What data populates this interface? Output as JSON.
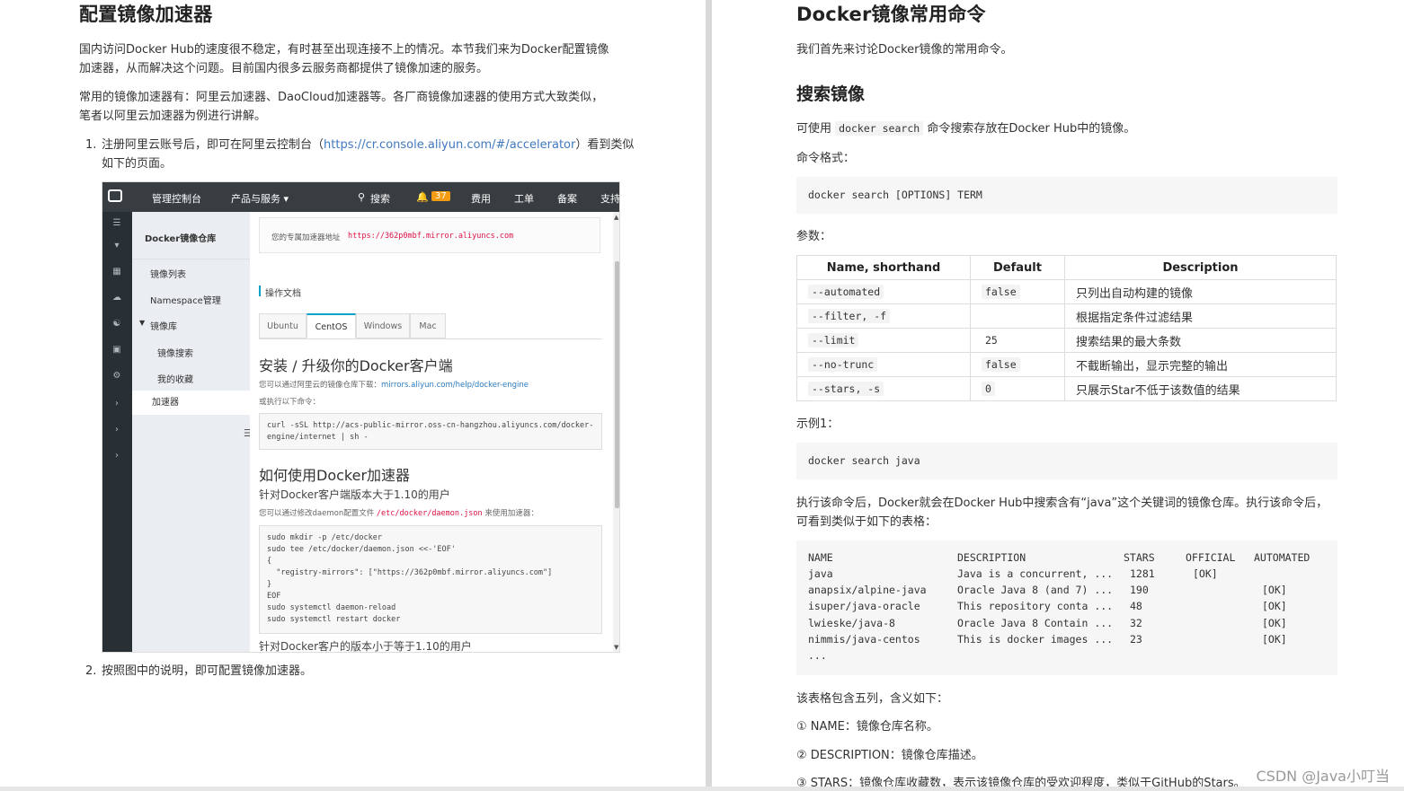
{
  "left": {
    "title": "配置镜像加速器",
    "para1_line1": "国内访问Docker Hub的速度很不稳定，有时甚至出现连接不上的情况。本节我们来为Docker配置镜像",
    "para1_line2": "加速器，从而解决这个问题。目前国内很多云服务商都提供了镜像加速的服务。",
    "para2_line1": "常用的镜像加速器有：阿里云加速器、DaoCloud加速器等。各厂商镜像加速器的使用方式大致类似，",
    "para2_line2": "笔者以阿里云加速器为例进行讲解。",
    "step1_num": "1.",
    "step1_pre": "注册阿里云账号后，即可在阿里云控制台（",
    "step1_link": "https://cr.console.aliyun.com/#/accelerator",
    "step1_post": "）看到类似",
    "step1_line2": "如下的页面。",
    "step2_num": "2.",
    "step2": "按照图中的说明，即可配置镜像加速器。",
    "console": {
      "top_nav": [
        "管理控制台",
        "产品与服务 ▾",
        "搜索",
        "费用",
        "工单",
        "备案",
        "支持"
      ],
      "bell_count": "37",
      "menu_title": "Docker镜像仓库",
      "menu_items": [
        "镜像列表",
        "Namespace管理",
        "镜像库",
        "镜像搜索",
        "我的收藏",
        "加速器"
      ],
      "addr_label": "您的专属加速器地址",
      "addr_url": "https://362p0mbf.mirror.aliyuncs.com",
      "doc_label": "操作文档",
      "tabs": [
        "Ubuntu",
        "CentOS",
        "Windows",
        "Mac"
      ],
      "h_install": "安装 / 升级你的Docker客户端",
      "install_note_pre": "您可以通过阿里云的镜像仓库下载：",
      "install_note_link": "mirrors.aliyun.com/help/docker-engine",
      "install_or": "或执行以下命令：",
      "install_code": "curl -sSL http://acs-public-mirror.oss-cn-hangzhou.aliyuncs.com/docker-\nengine/internet | sh -",
      "h_use": "如何使用Docker加速器",
      "sub_gt": "针对Docker客户端版本大于1.10的用户",
      "use_note_pre": "您可以通过修改daemon配置文件",
      "use_note_path": "/etc/docker/daemon.json",
      "use_note_post": "来使用加速器：",
      "use_code": "sudo mkdir -p /etc/docker\nsudo tee /etc/docker/daemon.json <<-'EOF'\n{\n  \"registry-mirrors\": [\"https://362p0mbf.mirror.aliyuncs.com\"]\n}\nEOF\nsudo systemctl daemon-reload\nsudo systemctl restart docker",
      "sub_le": "针对Docker客户的版本小于等于1.10的用户"
    }
  },
  "right": {
    "title": "Docker镜像常用命令",
    "intro": "我们首先来讨论Docker镜像的常用命令。",
    "h_search": "搜索镜像",
    "search_pre": "可使用",
    "search_cmd": "docker search",
    "search_post": "命令搜索存放在Docker Hub中的镜像。",
    "format_label": "命令格式：",
    "format_code": "docker search [OPTIONS] TERM",
    "params_label": "参数：",
    "params_headers": [
      "Name, shorthand",
      "Default",
      "Description"
    ],
    "params_rows": [
      {
        "name": "--automated",
        "default": "false",
        "desc": "只列出自动构建的镜像"
      },
      {
        "name": "--filter, -f",
        "default": "",
        "desc": "根据指定条件过滤结果"
      },
      {
        "name": "--limit",
        "default": "25",
        "desc": "搜索结果的最大条数"
      },
      {
        "name": "--no-trunc",
        "default": "false",
        "desc": "不截断输出，显示完整的输出"
      },
      {
        "name": "--stars, -s",
        "default": "0",
        "desc": "只展示Star不低于该数值的结果"
      }
    ],
    "example_label": "示例1：",
    "example_code": "docker search java",
    "after_line1": "执行该命令后，Docker就会在Docker Hub中搜索含有“java”这个关键词的镜像仓库。执行该命令后，",
    "after_line2": "可看到类似于如下的表格：",
    "result_headers": [
      "NAME",
      "DESCRIPTION",
      "STARS",
      "OFFICIAL",
      "AUTOMATED"
    ],
    "result_rows": [
      [
        "java",
        "Java is a concurrent, ...",
        "1281",
        "[OK]",
        ""
      ],
      [
        "anapsix/alpine-java",
        "Oracle Java 8 (and 7) ...",
        "190",
        "",
        "[OK]"
      ],
      [
        "isuper/java-oracle",
        "This repository conta ...",
        "48",
        "",
        "[OK]"
      ],
      [
        "lwieske/java-8",
        "Oracle Java 8 Contain ...",
        "32",
        "",
        "[OK]"
      ],
      [
        "nimmis/java-centos",
        "This is docker images ...",
        "23",
        "",
        "[OK]"
      ]
    ],
    "result_ellipsis": "...",
    "cols_intro": "该表格包含五列，含义如下：",
    "col1": "① NAME：镜像仓库名称。",
    "col2": "② DESCRIPTION：镜像仓库描述。",
    "col3": "③ STARS：镜像仓库收藏数，表示该镜像仓库的受欢迎程度，类似于GitHub的Stars。"
  },
  "watermark": "CSDN @Java小叮当"
}
